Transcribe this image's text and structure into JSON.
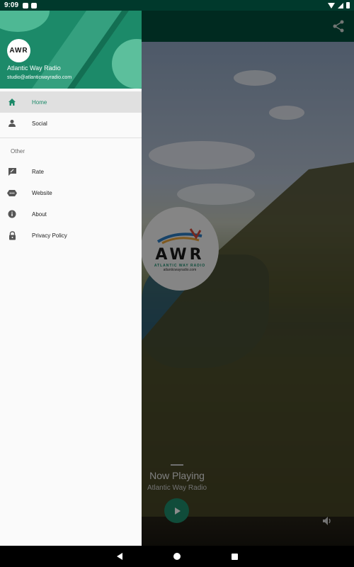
{
  "status_bar": {
    "time": "9:09"
  },
  "drawer": {
    "header": {
      "logo_text": "AWR",
      "name": "Atlantic Way Radio",
      "email": "studio@atlanticwayradio.com"
    },
    "items": [
      {
        "label": "Home",
        "icon": "home-icon"
      },
      {
        "label": "Social",
        "icon": "person-icon"
      }
    ],
    "section_label": "Other",
    "other_items": [
      {
        "label": "Rate",
        "icon": "rate-review-icon"
      },
      {
        "label": "Website",
        "icon": "web-icon"
      },
      {
        "label": "About",
        "icon": "info-icon"
      },
      {
        "label": "Privacy Policy",
        "icon": "lock-icon"
      }
    ]
  },
  "player": {
    "logo": {
      "text": "AWR",
      "subtitle": "ATLANTIC WAY RADIO",
      "url": "atlanticwayradio.com"
    },
    "now_playing": "Now Playing",
    "station": "Atlantic Way Radio"
  },
  "colors": {
    "accent": "#1c8a69",
    "app_bar": "#004d3b",
    "status_bar": "#00392c"
  }
}
